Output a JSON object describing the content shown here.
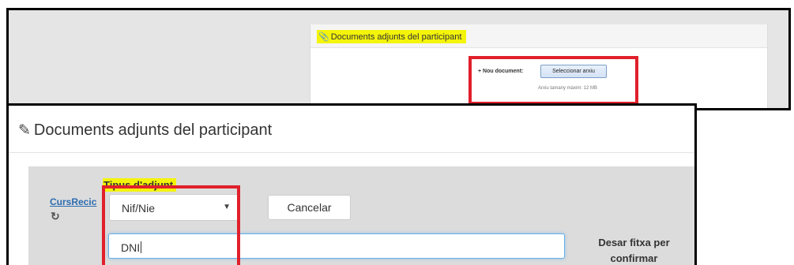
{
  "colors": {
    "highlight": "#f4f40a",
    "annotation_red": "#e0202b",
    "link_blue": "#2b6cb0",
    "panel_gray": "#dcdcdc"
  },
  "top_screenshot": {
    "panel_title": "Documents adjunts del participant",
    "title_icon": "paperclip-icon",
    "nou_document_label": "+ Nou document:",
    "select_file_button": "Seleccionar arxiu",
    "max_size_text": "Arxiu tamany màxim: 12 MB"
  },
  "front_screenshot": {
    "panel_title": "Documents adjunts del participant",
    "title_icon": "paperclip-icon",
    "attachment_type_label": "Tipus d'adjunt",
    "course_link": "CursRecic",
    "refresh_icon": "refresh-icon",
    "attachment_type_select": {
      "selected": "Nif/Nie"
    },
    "cancel_button": "Cancelar",
    "description_input_value": "DNI",
    "save_text": "Desar fitxa per confirmar"
  }
}
